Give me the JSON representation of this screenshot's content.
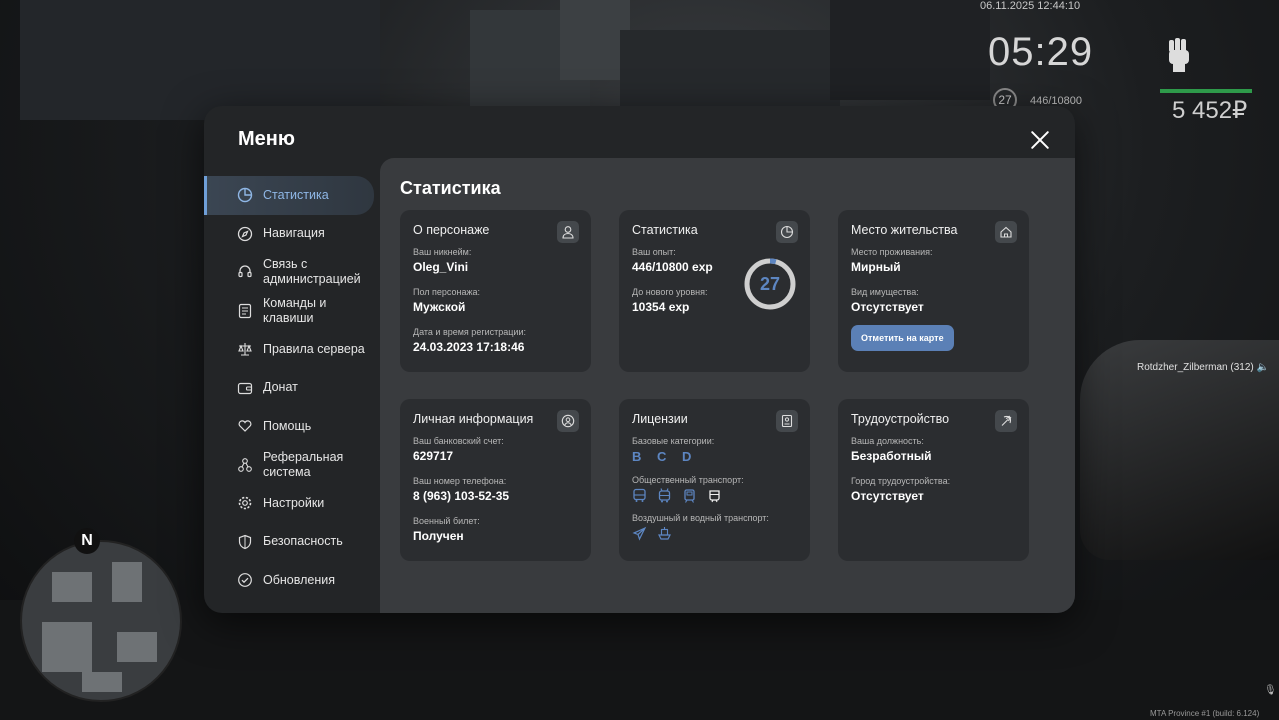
{
  "hud": {
    "date": "06.11.2025 12:44:10",
    "clock": "05:29",
    "level": "27",
    "exp": "446/10800",
    "money": "5 452₽",
    "player_label": "Rotdzher_Zilberman (312)",
    "build": "MTA Province #1 (build: 6.124)",
    "compass": "N"
  },
  "menu": {
    "title": "Меню",
    "sidebar": [
      {
        "label": "Статистика",
        "icon": "chart-pie-icon",
        "active": true
      },
      {
        "label": "Навигация",
        "icon": "compass-icon"
      },
      {
        "label": "Связь с администрацией",
        "icon": "headset-icon"
      },
      {
        "label": "Команды и клавиши",
        "icon": "keyboard-icon"
      },
      {
        "label": "Правила сервера",
        "icon": "scales-icon"
      },
      {
        "label": "Донат",
        "icon": "wallet-icon"
      },
      {
        "label": "Помощь",
        "icon": "heart-hand-icon"
      },
      {
        "label": "Реферальная система",
        "icon": "network-icon"
      },
      {
        "label": "Настройки",
        "icon": "gear-icon"
      },
      {
        "label": "Безопасность",
        "icon": "shield-icon"
      },
      {
        "label": "Обновления",
        "icon": "check-circle-icon"
      }
    ],
    "content_title": "Статистика",
    "cards": {
      "character": {
        "title": "О персонаже",
        "nickname_label": "Ваш никнейм:",
        "nickname": "Oleg_Vini",
        "gender_label": "Пол персонажа:",
        "gender": "Мужской",
        "reg_label": "Дата и время регистрации:",
        "reg": "24.03.2023 17:18:46"
      },
      "stats": {
        "title": "Статистика",
        "exp_label": "Ваш опыт:",
        "exp": "446/10800 exp",
        "next_label": "До нового уровня:",
        "next": "10354 exp",
        "level": "27",
        "progress": 0.041
      },
      "residence": {
        "title": "Место жительства",
        "place_label": "Место проживания:",
        "place": "Мирный",
        "property_label": "Вид имущества:",
        "property": "Отсутствует",
        "button": "Отметить на карте"
      },
      "personal": {
        "title": "Личная информация",
        "bank_label": "Ваш банковский счет:",
        "bank": "629717",
        "phone_label": "Ваш номер телефона:",
        "phone": "8 (963) 103-52-35",
        "military_label": "Военный билет:",
        "military": "Получен"
      },
      "licenses": {
        "title": "Лицензии",
        "base_label": "Базовые категории:",
        "base": "B C D",
        "public_label": "Общественный транспорт:",
        "air_label": "Воздушный и водный транспорт:"
      },
      "employment": {
        "title": "Трудоустройство",
        "position_label": "Ваша должность:",
        "position": "Безработный",
        "city_label": "Город трудоустройства:",
        "city": "Отсутствует"
      }
    }
  },
  "colors": {
    "accent": "#5d86c2",
    "panel": "#232527",
    "content": "#393b3e",
    "card": "#2b2d30"
  }
}
